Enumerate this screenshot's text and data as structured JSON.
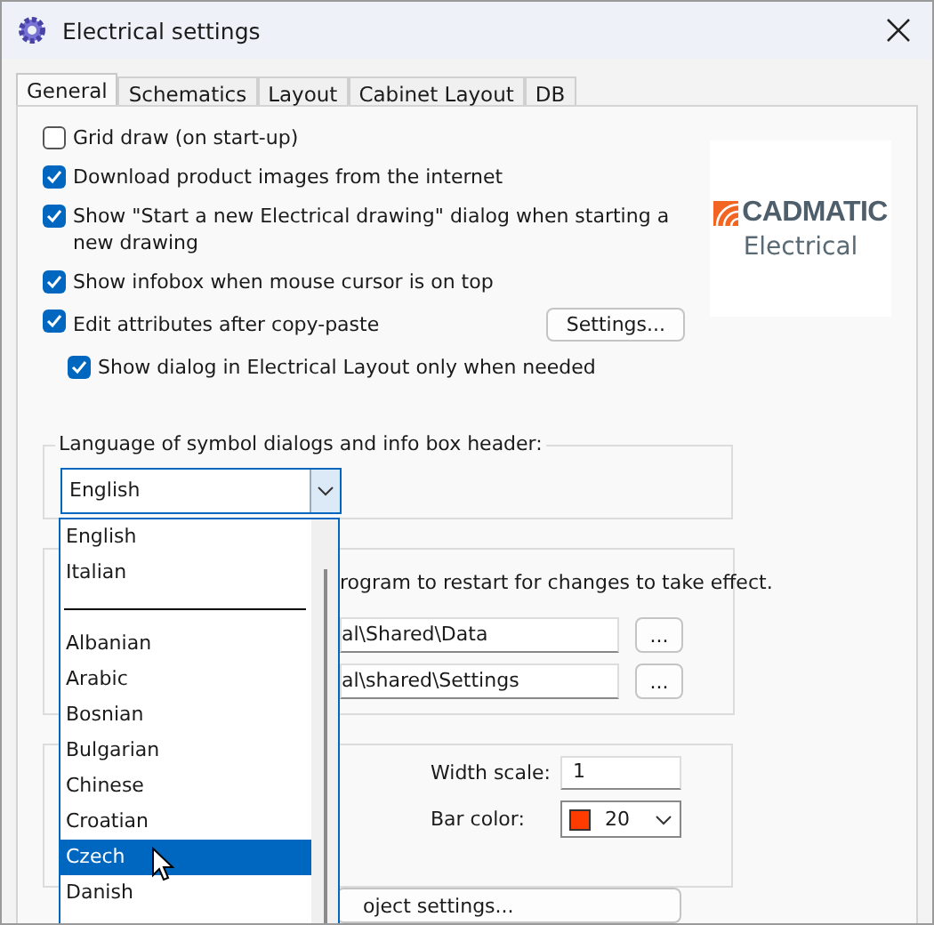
{
  "window": {
    "title": "Electrical settings"
  },
  "tabs": [
    {
      "label": "General",
      "selected": true
    },
    {
      "label": "Schematics",
      "selected": false
    },
    {
      "label": "Layout",
      "selected": false
    },
    {
      "label": "Cabinet Layout",
      "selected": false
    },
    {
      "label": "DB",
      "selected": false
    }
  ],
  "options": [
    {
      "label": "Grid draw (on start-up)",
      "checked": false,
      "indented": false
    },
    {
      "label": "Download product images from the internet",
      "checked": true,
      "indented": false
    },
    {
      "label": "Show \"Start a new Electrical drawing\" dialog when starting a new drawing",
      "checked": true,
      "indented": false
    },
    {
      "label": "Show infobox when mouse cursor is on top",
      "checked": true,
      "indented": false
    },
    {
      "label": "Edit attributes after copy-paste",
      "checked": true,
      "indented": false
    },
    {
      "label": "Show dialog in Electrical Layout only when needed",
      "checked": true,
      "indented": true
    }
  ],
  "settings_button": "Settings...",
  "logo": {
    "brand": "CADMATIC",
    "product": "Electrical"
  },
  "language_group": {
    "title": "Language of symbol dialogs and info box header:",
    "value": "English",
    "dropdown": [
      {
        "kind": "item",
        "label": "English",
        "highlighted": false
      },
      {
        "kind": "item",
        "label": "Italian",
        "highlighted": false
      },
      {
        "kind": "separator"
      },
      {
        "kind": "item",
        "label": "Albanian",
        "highlighted": false
      },
      {
        "kind": "item",
        "label": "Arabic",
        "highlighted": false
      },
      {
        "kind": "item",
        "label": "Bosnian",
        "highlighted": false
      },
      {
        "kind": "item",
        "label": "Bulgarian",
        "highlighted": false
      },
      {
        "kind": "item",
        "label": "Chinese",
        "highlighted": false
      },
      {
        "kind": "item",
        "label": "Croatian",
        "highlighted": false
      },
      {
        "kind": "item",
        "label": "Czech",
        "highlighted": true
      },
      {
        "kind": "item",
        "label": "Danish",
        "highlighted": false
      }
    ]
  },
  "paths_group": {
    "note": "rogram to restart for changes to take effect.",
    "paths": [
      {
        "value": "al\\Shared\\Data",
        "button": "..."
      },
      {
        "value": "al\\shared\\Settings",
        "button": "..."
      }
    ]
  },
  "display_group": {
    "width_scale": {
      "label": "Width scale:",
      "value": "1"
    },
    "bar_color": {
      "label": "Bar color:",
      "value": "20",
      "color": "#ff3c00"
    }
  },
  "project_settings_button": "oject settings..."
}
